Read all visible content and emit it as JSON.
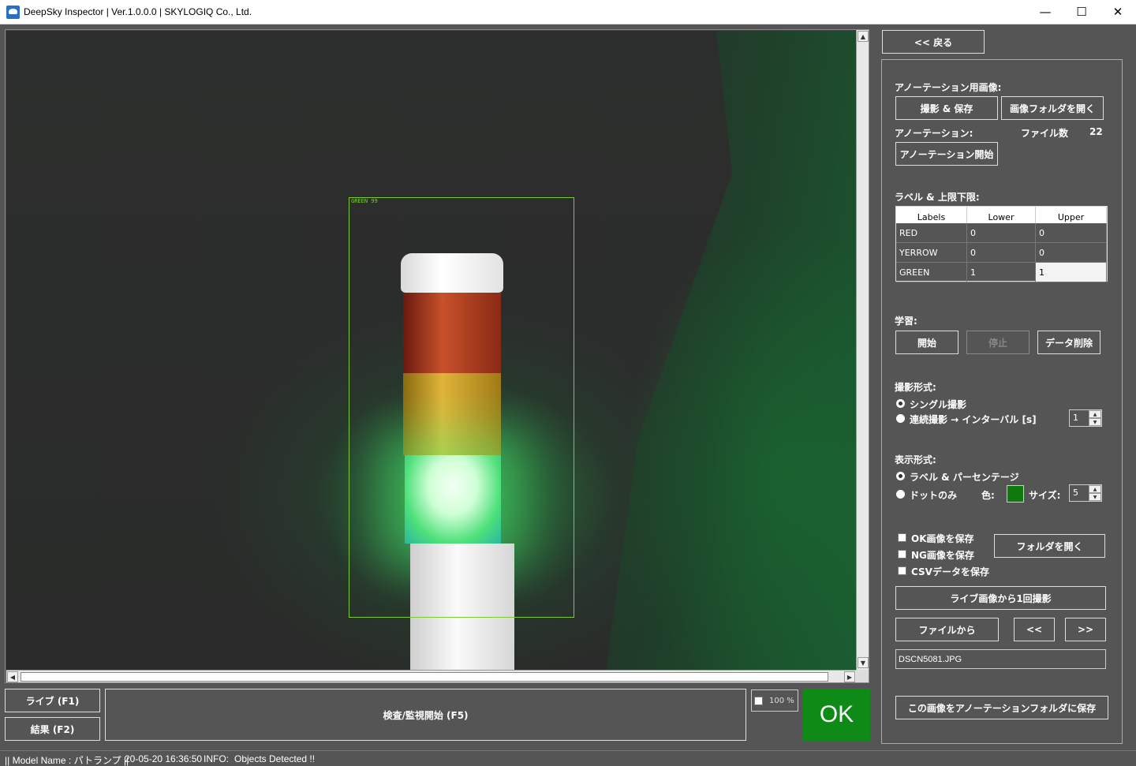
{
  "window": {
    "title": "DeepSky Inspector | Ver.1.0.0.0 | SKYLOGIQ Co., Ltd.",
    "minimize": "—",
    "maximize": "☐",
    "close": "✕"
  },
  "viewer": {
    "detection_label": "GREEN 99",
    "scroll_up": "▲",
    "scroll_down": "▼",
    "scroll_left": "◀",
    "scroll_right": "▶"
  },
  "bottom_bar": {
    "live_button": "ライブ (F1)",
    "result_button": "結果 (F2)",
    "inspect_button": "検査/監視開始 (F5)",
    "zoom_text": "100 %",
    "judgement": "OK"
  },
  "right_panel": {
    "back_button": "<< 戻る",
    "annotation_image_label": "アノーテーション用画像:",
    "capture_save_button": "撮影 & 保存",
    "open_image_folder_button": "画像フォルダを開く",
    "annotation_label": "アノーテーション:",
    "file_count_label": "ファイル数",
    "file_count_value": "22",
    "annotation_start_button": "アノーテーション開始",
    "labels_limits_label": "ラベル & 上限下限:",
    "grid": {
      "headers": [
        "Labels",
        "Lower",
        "Upper"
      ],
      "rows": [
        {
          "label": "RED",
          "lower": "0",
          "upper": "0"
        },
        {
          "label": "YERROW",
          "lower": "0",
          "upper": "0"
        },
        {
          "label": "GREEN",
          "lower": "1",
          "upper": "1"
        }
      ]
    },
    "learning_label": "学習:",
    "learn_start_button": "開始",
    "learn_stop_button": "停止",
    "data_delete_button": "データ削除",
    "capture_mode_label": "撮影形式:",
    "single_capture": "シングル撮影",
    "continuous_capture": "連続撮影 → インターバル [s]",
    "interval_value": "1",
    "display_mode_label": "表示形式:",
    "label_percentage": "ラベル & パーセンテージ",
    "dot_only": "ドットのみ",
    "color_label": "色:",
    "size_label": "サイズ:",
    "size_value": "5",
    "accent_color": "#0e7a0e",
    "save_ok_images": "OK画像を保存",
    "save_ng_images": "NG画像を保存",
    "save_csv": "CSVデータを保存",
    "open_folder_button": "フォルダを開く",
    "capture_once_button": "ライブ画像から1回撮影",
    "from_file_button": "ファイルから",
    "prev_button": "<<",
    "next_button": ">>",
    "filename": "DSCN5081.JPG",
    "save_to_annotation_button": "この画像をアノーテーションフォルダに保存"
  },
  "status_bar": {
    "model": "|| Model Name : パトランプ ||",
    "timestamp": "20-05-20 16:36:50",
    "info_label": "INFO:",
    "info_message": "Objects Detected !!"
  },
  "ok_color": "#0e8a17"
}
